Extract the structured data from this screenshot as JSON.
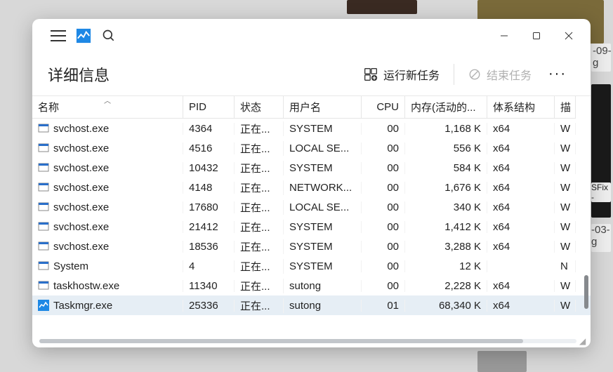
{
  "window": {
    "title": "详细信息",
    "run_new_task": "运行新任务",
    "end_task": "结束任务",
    "more": "···"
  },
  "columns": {
    "name": "名称",
    "pid": "PID",
    "status": "状态",
    "user": "用户名",
    "cpu": "CPU",
    "memory": "内存(活动的...",
    "arch": "体系结构",
    "desc": "描"
  },
  "rows": [
    {
      "name": "svchost.exe",
      "pid": "4364",
      "status": "正在...",
      "user": "SYSTEM",
      "cpu": "00",
      "mem": "1,168 K",
      "arch": "x64",
      "desc": "W",
      "icon": "generic"
    },
    {
      "name": "svchost.exe",
      "pid": "4516",
      "status": "正在...",
      "user": "LOCAL SE...",
      "cpu": "00",
      "mem": "556 K",
      "arch": "x64",
      "desc": "W",
      "icon": "generic"
    },
    {
      "name": "svchost.exe",
      "pid": "10432",
      "status": "正在...",
      "user": "SYSTEM",
      "cpu": "00",
      "mem": "584 K",
      "arch": "x64",
      "desc": "W",
      "icon": "generic"
    },
    {
      "name": "svchost.exe",
      "pid": "4148",
      "status": "正在...",
      "user": "NETWORK...",
      "cpu": "00",
      "mem": "1,676 K",
      "arch": "x64",
      "desc": "W",
      "icon": "generic"
    },
    {
      "name": "svchost.exe",
      "pid": "17680",
      "status": "正在...",
      "user": "LOCAL SE...",
      "cpu": "00",
      "mem": "340 K",
      "arch": "x64",
      "desc": "W",
      "icon": "generic"
    },
    {
      "name": "svchost.exe",
      "pid": "21412",
      "status": "正在...",
      "user": "SYSTEM",
      "cpu": "00",
      "mem": "1,412 K",
      "arch": "x64",
      "desc": "W",
      "icon": "generic"
    },
    {
      "name": "svchost.exe",
      "pid": "18536",
      "status": "正在...",
      "user": "SYSTEM",
      "cpu": "00",
      "mem": "3,288 K",
      "arch": "x64",
      "desc": "W",
      "icon": "generic"
    },
    {
      "name": "System",
      "pid": "4",
      "status": "正在...",
      "user": "SYSTEM",
      "cpu": "00",
      "mem": "12 K",
      "arch": "",
      "desc": "N",
      "icon": "generic"
    },
    {
      "name": "taskhostw.exe",
      "pid": "11340",
      "status": "正在...",
      "user": "sutong",
      "cpu": "00",
      "mem": "2,228 K",
      "arch": "x64",
      "desc": "W",
      "icon": "generic"
    },
    {
      "name": "Taskmgr.exe",
      "pid": "25336",
      "status": "正在...",
      "user": "sutong",
      "cpu": "01",
      "mem": "68,340 K",
      "arch": "x64",
      "desc": "W",
      "icon": "taskmgr",
      "selected": true
    }
  ]
}
